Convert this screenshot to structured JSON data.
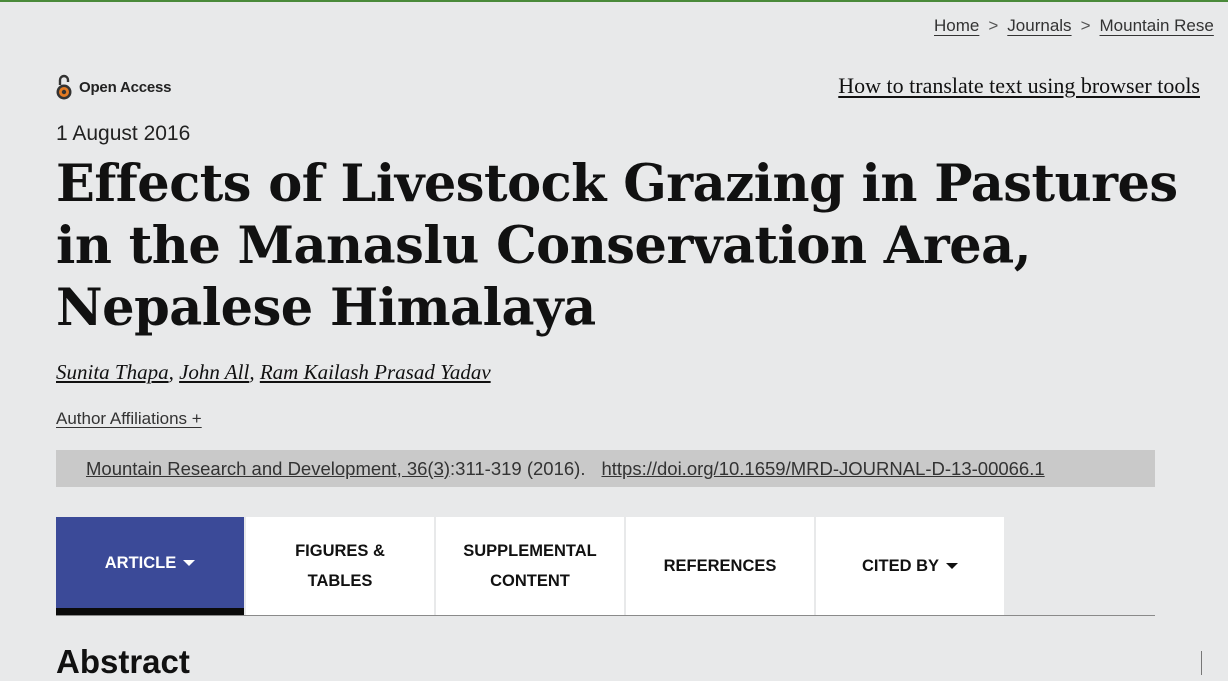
{
  "breadcrumb": [
    {
      "label": "Home"
    },
    {
      "label": "Journals"
    },
    {
      "label": "Mountain Rese"
    }
  ],
  "breadcrumb_separator": ">",
  "open_access": {
    "label": "Open Access",
    "icon": "open-lock-icon",
    "color": "#e37a22"
  },
  "translate_link": "How to translate text using browser tools",
  "publication_date": "1 August 2016",
  "title": "Effects of Livestock Grazing in Pastures in the Manaslu Conservation Area, Nepalese Himalaya",
  "authors": [
    {
      "name": "Sunita Thapa"
    },
    {
      "name": "John All"
    },
    {
      "name": "Ram Kailash Prasad Yadav"
    }
  ],
  "author_affiliations": "Author Affiliations +",
  "citation": {
    "journal_link": "Mountain Research and Development, 36(3)",
    "pages_year": ":311-319 (2016).",
    "doi": "https://doi.org/10.1659/MRD-JOURNAL-D-13-00066.1"
  },
  "tabs": [
    {
      "line1": "ARTICLE",
      "line2": "",
      "active": true,
      "dropdown": true
    },
    {
      "line1": "FIGURES &",
      "line2": "TABLES",
      "active": false,
      "dropdown": false
    },
    {
      "line1": "SUPPLEMENTAL",
      "line2": "CONTENT",
      "active": false,
      "dropdown": false
    },
    {
      "line1": "REFERENCES",
      "line2": "",
      "active": false,
      "dropdown": false
    },
    {
      "line1": "CITED BY",
      "line2": "",
      "active": false,
      "dropdown": true
    }
  ],
  "section_heading": "Abstract",
  "colors": {
    "active_tab": "#3b4a98",
    "background": "#e8e9ea",
    "citation_bar": "#c9c9c9"
  }
}
